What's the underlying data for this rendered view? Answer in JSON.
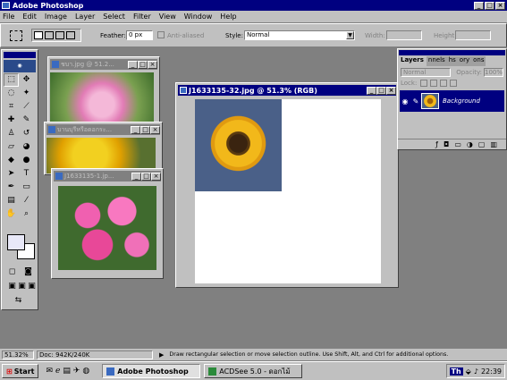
{
  "app": {
    "title": "Adobe Photoshop"
  },
  "menu": [
    "File",
    "Edit",
    "Image",
    "Layer",
    "Select",
    "Filter",
    "View",
    "Window",
    "Help"
  ],
  "options_bar": {
    "feather_label": "Feather:",
    "feather_value": "0 px",
    "anti_aliased_label": "Anti-aliased",
    "style_label": "Style:",
    "style_value": "Normal",
    "width_label": "Width:",
    "height_label": "Height:"
  },
  "windows": [
    {
      "title": "ชบา.jpg @ 51.2...",
      "image": "pink-hibiscus"
    },
    {
      "title": "บานบุรีหรือดอกระ...",
      "image": "yellow-flowers"
    },
    {
      "title": "J1633135-1.jp...",
      "image": "pink-flowers"
    },
    {
      "title": "J1633135-32.jpg @ 51.3% (RGB)",
      "image": "sunflower"
    }
  ],
  "layers_panel": {
    "tabs": [
      "Layers",
      "Channels",
      "Paths",
      "History",
      "Actions"
    ],
    "tab_labels_visible": [
      "Layers",
      "nnels",
      "hs",
      "ory",
      "ons"
    ],
    "blend_mode": "Normal",
    "opacity_label": "Opacity:",
    "opacity_value": "100%",
    "lock_label": "Lock:",
    "layer_name": "Background"
  },
  "status": {
    "zoom": "51.32%",
    "doc": "Doc: 942K/240K",
    "hint": "Draw rectangular selection or move selection outline. Use Shift, Alt, and Ctrl for additional options."
  },
  "taskbar": {
    "start": "Start",
    "tasks": [
      "Adobe Photoshop",
      "ACDSee 5.0 - ดอกไม้"
    ],
    "lang": "Th",
    "time": "22:39"
  },
  "colors": {
    "titlebar": "#000080",
    "face": "#c0c0c0",
    "desktop": "#808080"
  }
}
